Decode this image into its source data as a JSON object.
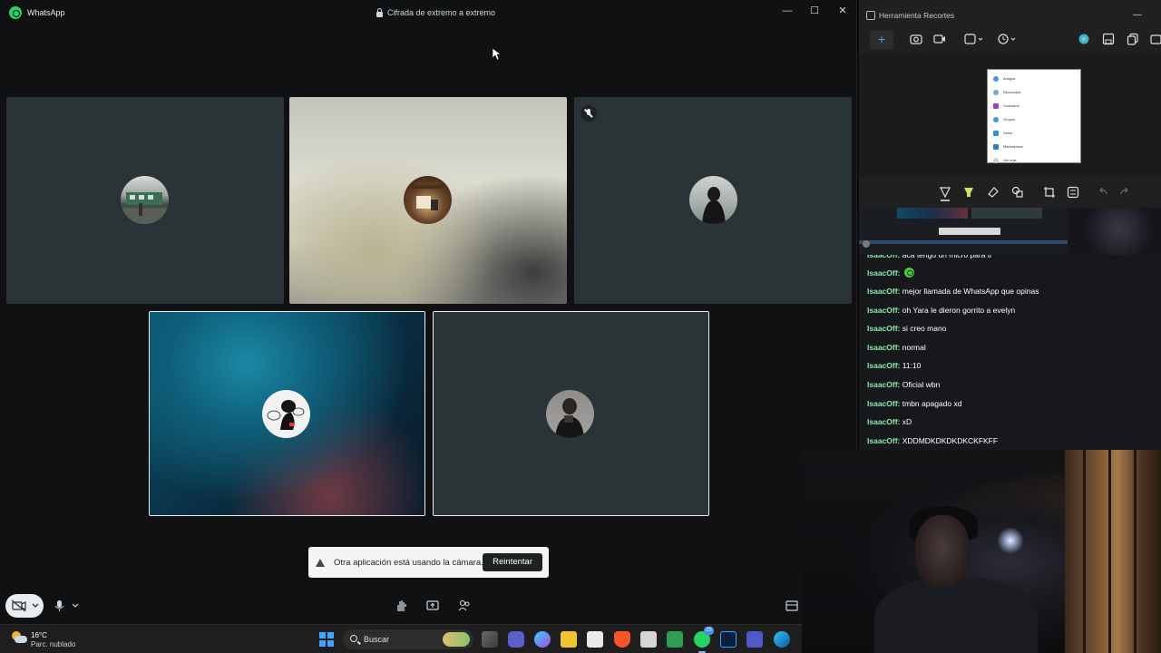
{
  "whatsapp": {
    "app_title": "WhatsApp",
    "encryption_label": "Cifrada de extremo a extremo",
    "window_controls": {
      "minimize": "—",
      "maximize": "☐",
      "close": "✕"
    }
  },
  "call": {
    "participants": [
      {
        "id": "p1",
        "avatar": "avatar-train"
      },
      {
        "id": "p2",
        "avatar": "avatar-shelf"
      },
      {
        "id": "p3",
        "avatar": "avatar-girl",
        "muted": true
      },
      {
        "id": "p4",
        "avatar": "avatar-cartoon",
        "highlighted": true
      },
      {
        "id": "p5",
        "avatar": "avatar-person",
        "highlighted": true
      }
    ],
    "toast": {
      "message": "Otra aplicación está usando la cámara.",
      "button": "Reintentar"
    },
    "controls": {
      "camera": "camera-off-icon",
      "mic": "microphone-icon",
      "raise_hand": "hand-icon",
      "share": "share-screen-icon",
      "add": "add-participant-icon",
      "layout": "layout-icon"
    }
  },
  "snipping_tool": {
    "title": "Herramienta Recortes",
    "preview_items": [
      "Amigos",
      "Recuerdos",
      "Guardado",
      "Grupos",
      "Video",
      "Marketplace",
      "Ver más"
    ]
  },
  "chat": {
    "messages": [
      {
        "user": "IsaacOff",
        "text": "",
        "emoji": true
      },
      {
        "user": "IsaacOff",
        "text": "mejor llamada de WhatsApp que opinas"
      },
      {
        "user": "IsaacOff",
        "text": "oh Yara le dieron gorrito a evelyn"
      },
      {
        "user": "IsaacOff",
        "text": "si creo mano"
      },
      {
        "user": "IsaacOff",
        "text": "normal"
      },
      {
        "user": "IsaacOff",
        "text": "11:10"
      },
      {
        "user": "IsaacOff",
        "text": "Oficial wbn"
      },
      {
        "user": "IsaacOff",
        "text": "tmbn apagado xd"
      },
      {
        "user": "IsaacOff",
        "text": "xD"
      },
      {
        "user": "IsaacOff",
        "text": "XDDMDKDKDKDKCKFKFF"
      }
    ]
  },
  "taskbar": {
    "weather_temp": "16°C",
    "weather_condition": "Parc. nublado",
    "search_label": "Buscar",
    "whatsapp_badge": "25"
  },
  "colors": {
    "whatsapp_green": "#25d366",
    "chat_username": "#8fe8a8",
    "tile_bg": "#2a3335",
    "accent_blue": "#3ea6ff"
  }
}
